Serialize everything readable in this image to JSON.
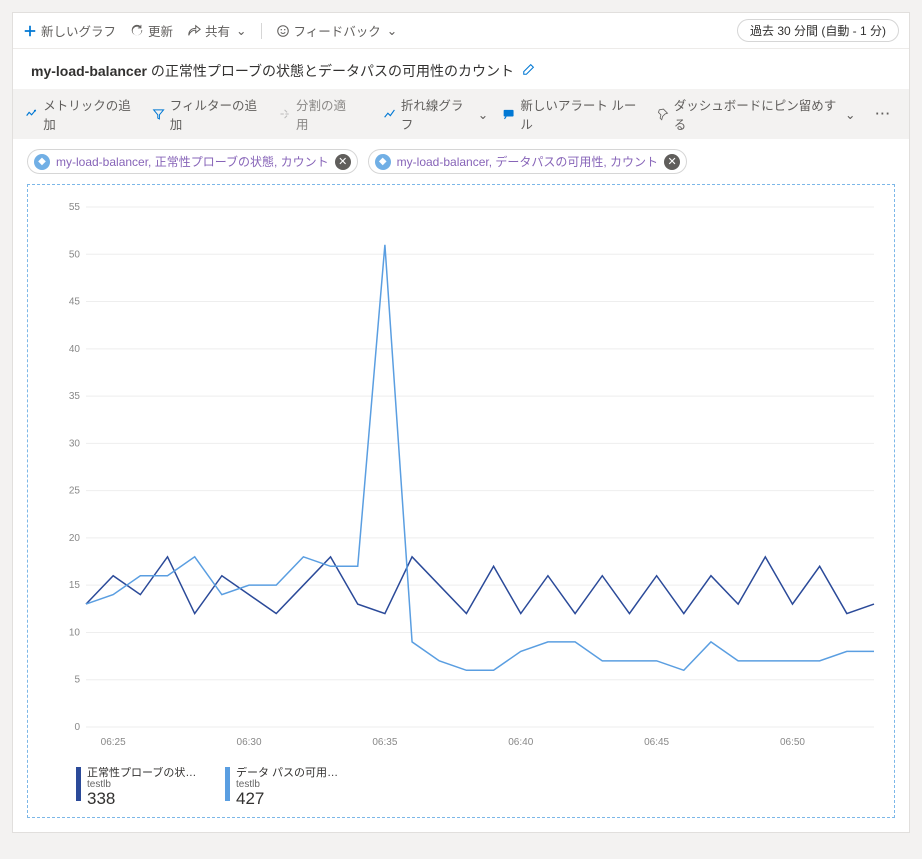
{
  "toolbar": {
    "new_chart": "新しいグラフ",
    "refresh": "更新",
    "share": "共有",
    "feedback": "フィードバック",
    "time_range": "過去 30 分間 (自動 - 1 分)"
  },
  "title": {
    "resource": "my-load-balancer",
    "rest": " の正常性プローブの状態とデータパスの可用性のカウント"
  },
  "cmdbar": {
    "add_metric": "メトリックの追加",
    "add_filter": "フィルターの追加",
    "apply_split": "分割の適用",
    "chart_type": "折れ線グラフ",
    "new_alert": "新しいアラート ルール",
    "pin_dashboard": "ダッシュボードにピン留めする"
  },
  "chips": [
    {
      "text": "my-load-balancer, 正常性プローブの状態, カウント"
    },
    {
      "text": "my-load-balancer, データパスの可用性, カウント"
    }
  ],
  "legend": [
    {
      "name": "正常性プローブの状態...",
      "resource": "testlb",
      "value": "338",
      "color": "#2b4a99"
    },
    {
      "name": "データ パスの可用性...",
      "resource": "testlb",
      "value": "427",
      "color": "#5a9ee1"
    }
  ],
  "chart_data": {
    "type": "line",
    "xlabel": "",
    "ylabel": "",
    "ylim": [
      0,
      55
    ],
    "x_ticks": [
      "06:25",
      "06:30",
      "06:35",
      "06:40",
      "06:45",
      "06:50"
    ],
    "y_ticks": [
      0,
      5,
      10,
      15,
      20,
      25,
      30,
      35,
      40,
      45,
      50,
      55
    ],
    "x": [
      "06:24",
      "06:25",
      "06:26",
      "06:27",
      "06:28",
      "06:29",
      "06:30",
      "06:31",
      "06:32",
      "06:33",
      "06:34",
      "06:35",
      "06:36",
      "06:37",
      "06:38",
      "06:39",
      "06:40",
      "06:41",
      "06:42",
      "06:43",
      "06:44",
      "06:45",
      "06:46",
      "06:47",
      "06:48",
      "06:49",
      "06:50",
      "06:51",
      "06:52",
      "06:53"
    ],
    "series": [
      {
        "name": "正常性プローブの状態",
        "color": "#2b4a99",
        "values": [
          13,
          16,
          14,
          18,
          12,
          16,
          14,
          12,
          15,
          18,
          13,
          12,
          18,
          15,
          12,
          17,
          12,
          16,
          12,
          16,
          12,
          16,
          12,
          16,
          13,
          18,
          13,
          17,
          12,
          13
        ]
      },
      {
        "name": "データパスの可用性",
        "color": "#5a9ee1",
        "values": [
          13,
          14,
          16,
          16,
          18,
          14,
          15,
          15,
          18,
          17,
          17,
          51,
          9,
          7,
          6,
          6,
          8,
          9,
          9,
          7,
          7,
          7,
          6,
          9,
          7,
          7,
          7,
          7,
          8,
          8
        ]
      }
    ]
  }
}
